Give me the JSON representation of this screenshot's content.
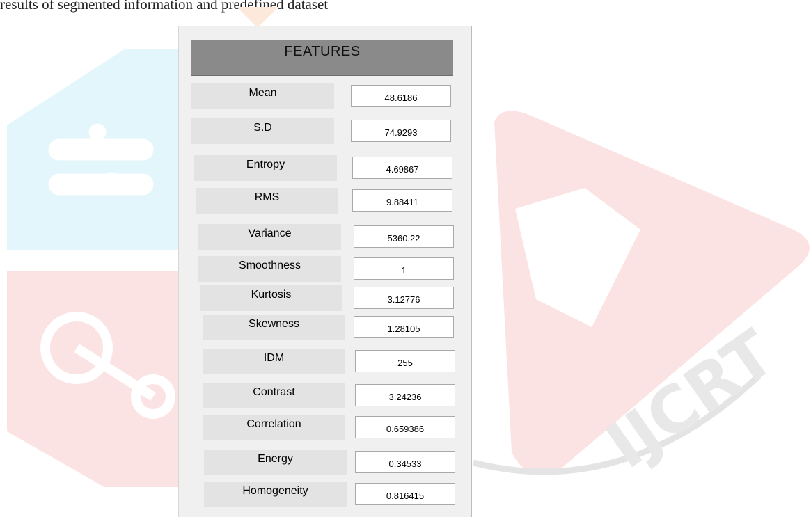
{
  "caption": "results of segmented information and predefined dataset",
  "panel": {
    "title": "FEATURES",
    "features": [
      {
        "label": "Mean",
        "value": "48.6186"
      },
      {
        "label": "S.D",
        "value": "74.9293"
      },
      {
        "label": "Entropy",
        "value": "4.69867"
      },
      {
        "label": "RMS",
        "value": "9.88411"
      },
      {
        "label": "Variance",
        "value": "5360.22"
      },
      {
        "label": "Smoothness",
        "value": "1"
      },
      {
        "label": "Kurtosis",
        "value": "3.12776"
      },
      {
        "label": "Skewness",
        "value": "1.28105"
      },
      {
        "label": "IDM",
        "value": "255"
      },
      {
        "label": "Contrast",
        "value": "3.24236"
      },
      {
        "label": "Correlation",
        "value": "0.659386"
      },
      {
        "label": "Energy",
        "value": "0.34533"
      },
      {
        "label": "Homogeneity",
        "value": "0.816415"
      }
    ]
  },
  "watermark": {
    "text": "IJCRT",
    "colors": {
      "cyan": "#e2f6fb",
      "pink": "#fbe3e3",
      "orange": "#fde9dc",
      "grey": "#ececec"
    }
  }
}
